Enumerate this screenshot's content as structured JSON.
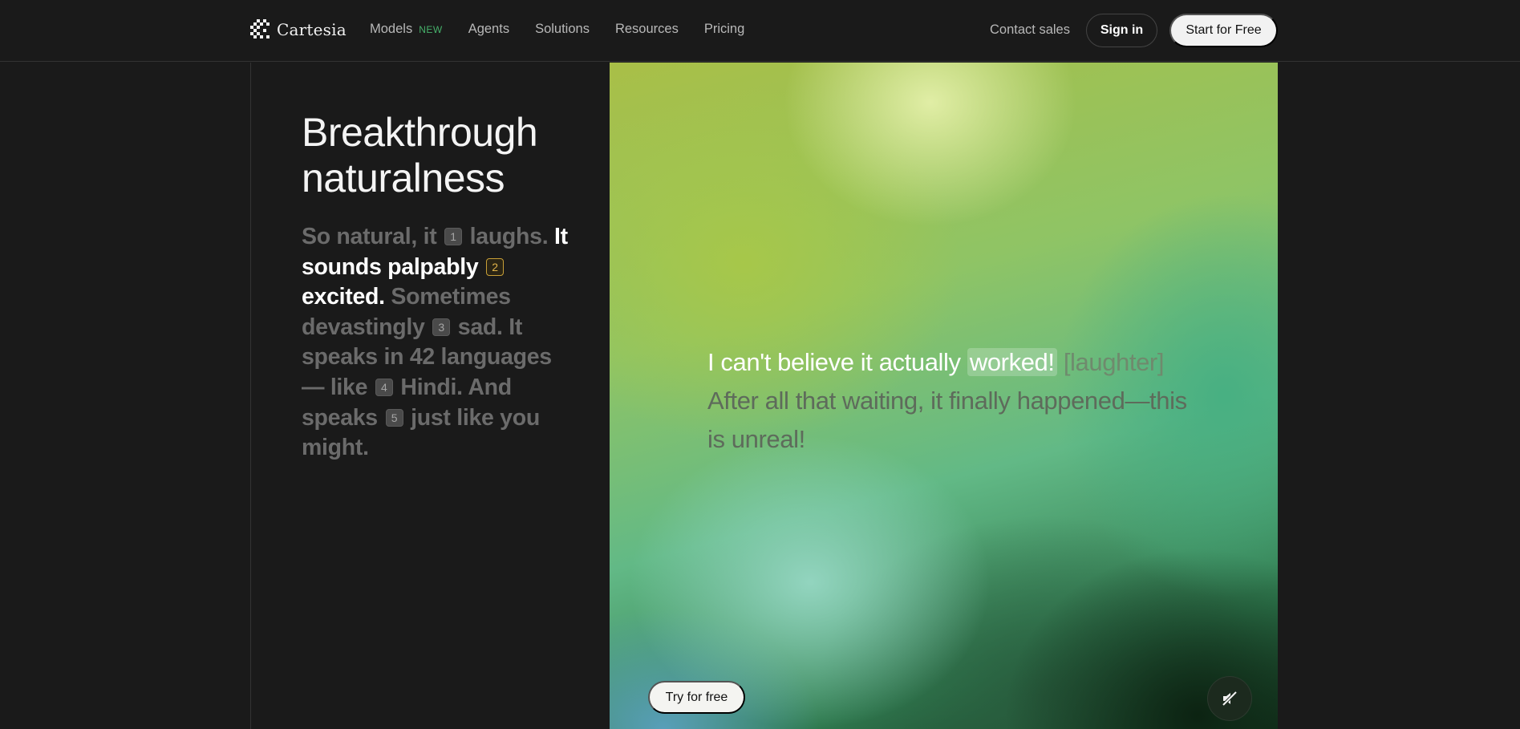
{
  "brand": {
    "name": "Cartesia",
    "logo_icon": "cartesia-checker-logo"
  },
  "nav": {
    "items": [
      {
        "label": "Models",
        "badge": "NEW"
      },
      {
        "label": "Agents"
      },
      {
        "label": "Solutions"
      },
      {
        "label": "Resources"
      },
      {
        "label": "Pricing"
      }
    ],
    "contact_label": "Contact sales",
    "signin_label": "Sign in",
    "start_label": "Start for Free"
  },
  "hero": {
    "heading_line1": "Breakthrough",
    "heading_line2": "naturalness",
    "copy": {
      "s1": "So natural, it",
      "n1": "1",
      "s2": "laughs.",
      "s3": "It sounds palpably",
      "n2": "2",
      "s4": "excited.",
      "s5": "Sometimes devastingly",
      "n3": "3",
      "s6": "sad. It speaks in 42 languages — like",
      "n4": "4",
      "s7": "Hindi. And speaks",
      "n5": "5",
      "s8": "just like you might."
    },
    "active_sample": "2"
  },
  "demo": {
    "spoken": "I can't believe it actually",
    "current_word": "worked!",
    "tag": "[laughter]",
    "remaining": "After all that waiting, it finally happened—this is unreal!",
    "try_label": "Try for free",
    "mute_icon": "speaker-muted-icon"
  },
  "colors": {
    "background": "#1a1a1a",
    "badge_new": "#46b06a",
    "active_number": "#e0b34a",
    "muted_text": "#6b6b6b"
  }
}
